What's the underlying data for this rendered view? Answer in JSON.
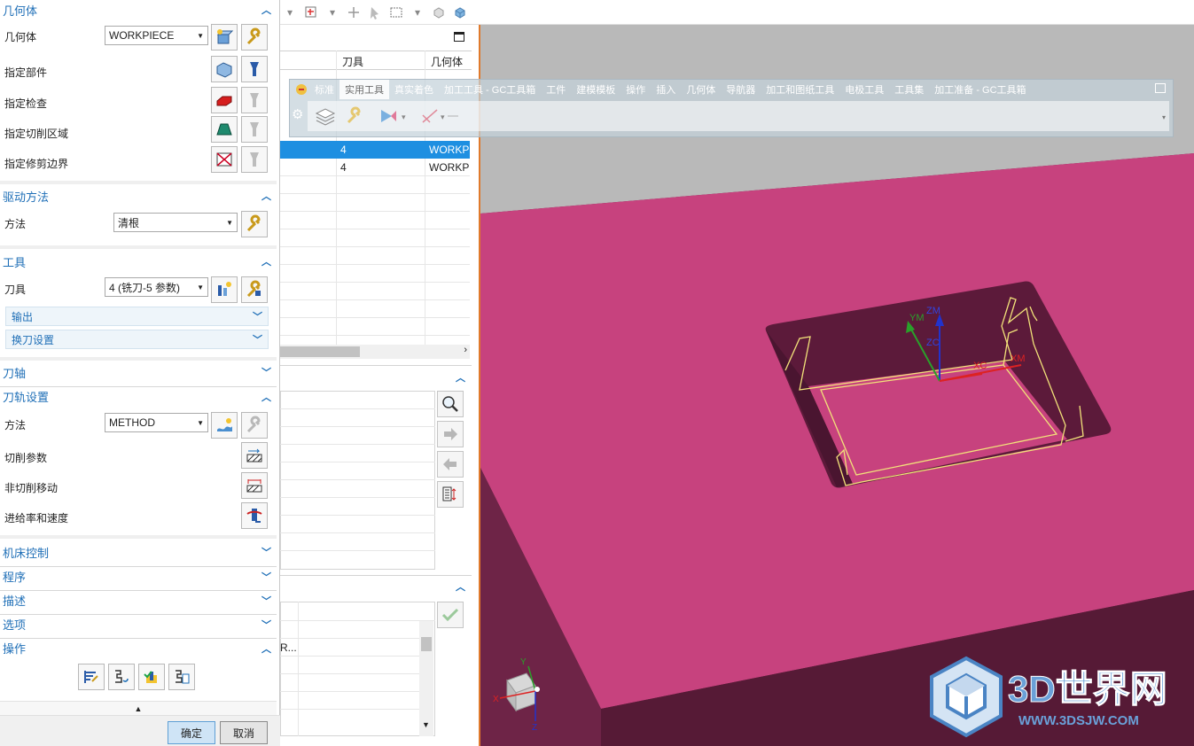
{
  "dialog": {
    "geometry": {
      "title": "几何体",
      "geometry_label": "几何体",
      "geometry_value": "WORKPIECE",
      "specify_part": "指定部件",
      "specify_check": "指定检查",
      "specify_cut_area": "指定切削区域",
      "specify_trim": "指定修剪边界"
    },
    "drive": {
      "title": "驱动方法",
      "method_label": "方法",
      "method_value": "清根"
    },
    "tool": {
      "title": "工具",
      "tool_label": "刀具",
      "tool_value": "4 (铣刀-5 参数)",
      "output": "输出",
      "tool_change": "换刀设置"
    },
    "tool_axis": {
      "title": "刀轴"
    },
    "path_settings": {
      "title": "刀轨设置",
      "method_label": "方法",
      "method_value": "METHOD",
      "cut_params": "切削参数",
      "non_cut_moves": "非切削移动",
      "feeds_speeds": "进给率和速度"
    },
    "machine_control": "机床控制",
    "program": "程序",
    "description": "描述",
    "options": "选项",
    "actions": {
      "title": "操作"
    },
    "ok_label": "确定",
    "cancel_label": "取消"
  },
  "navigator": {
    "columns": [
      "刀具",
      "几何体"
    ],
    "rows": [
      {
        "tool": "4",
        "geometry": "WORKP",
        "selected": true
      },
      {
        "tool": "4",
        "geometry": "WORKP",
        "selected": false
      }
    ],
    "truncated_text": "R..."
  },
  "ribbon": {
    "tabs": [
      "标准",
      "实用工具",
      "真实着色",
      "加工工具 - GC工具箱",
      "工件",
      "建模模板",
      "操作",
      "插入",
      "几何体",
      "导航器",
      "加工和图纸工具",
      "电极工具",
      "工具集",
      "加工准备 - GC工具箱"
    ],
    "active_tab": "实用工具"
  },
  "viewport": {
    "csys_labels": {
      "ym": "YM",
      "zm": "ZM",
      "zc": "ZC",
      "xc": "XC",
      "xm": "XM"
    },
    "triad_labels": {
      "x": "X",
      "y": "Y",
      "z": "Z"
    },
    "colors": {
      "face": "#c7427e",
      "wall": "#5a1d3a",
      "top": "#b9b9b9",
      "toolpath": "#f2e27a"
    }
  },
  "watermark": {
    "text": "3D世界网",
    "url": "WWW.3DSJW.COM"
  }
}
